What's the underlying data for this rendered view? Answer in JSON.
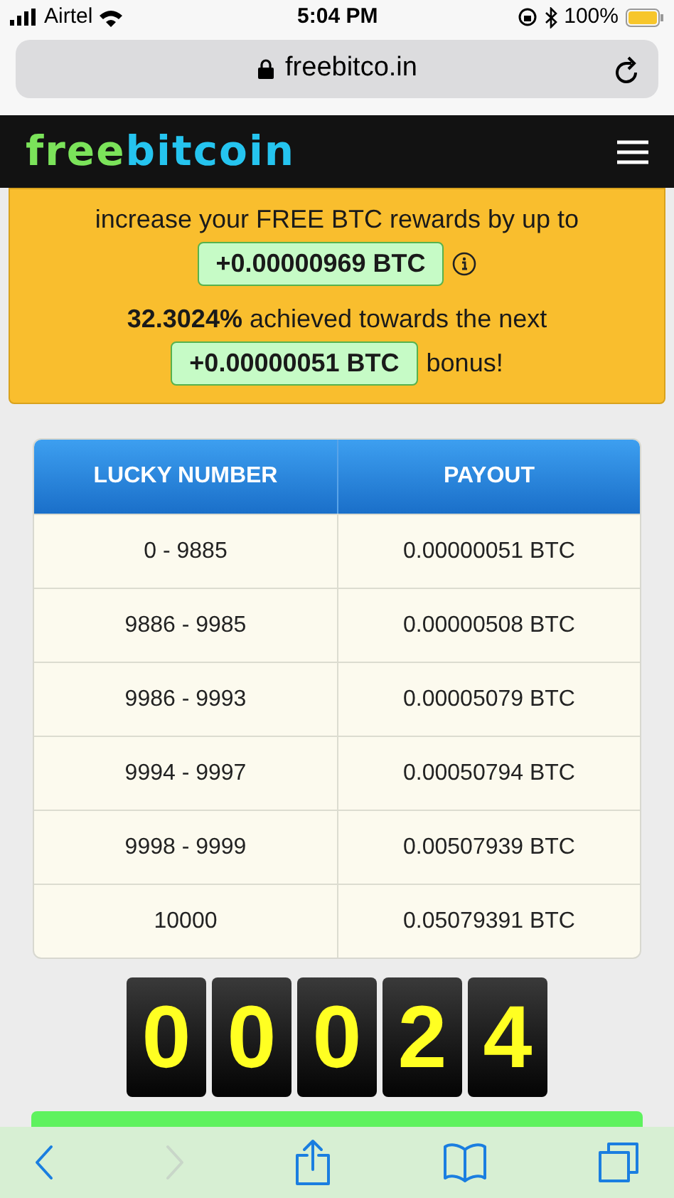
{
  "status_bar": {
    "carrier": "Airtel",
    "time": "5:04 PM",
    "battery": "100%"
  },
  "browser": {
    "url": "freebitco.in"
  },
  "site_header": {
    "logo_first": "free",
    "logo_second": "bitcoin"
  },
  "notice": {
    "line": "increase your FREE BTC rewards by up to",
    "reward": "+0.00000969 BTC",
    "progress": "**32.3024%** achieved towards the next",
    "bonus": "+0.00000051 BTC",
    "bonus_suffix": "bonus!"
  },
  "table": {
    "columns": [
      "LUCKY NUMBER",
      "PAYOUT"
    ],
    "rows": [
      [
        "0 - 9885",
        "0.00000051 BTC"
      ],
      [
        "9886 - 9985",
        "0.00000508 BTC"
      ],
      [
        "9986 - 9993",
        "0.00005079 BTC"
      ],
      [
        "9994 - 9997",
        "0.00050794 BTC"
      ],
      [
        "9998 - 9999",
        "0.00507939 BTC"
      ],
      [
        "10000",
        "0.05079391 BTC"
      ]
    ]
  },
  "digits": [
    "0",
    "0",
    "0",
    "2",
    "4"
  ],
  "toolbar": [
    {
      "kind": "back",
      "disabled": false
    },
    {
      "kind": "forward",
      "disabled": true
    },
    {
      "kind": "share",
      "disabled": false
    },
    {
      "kind": "bookmarks",
      "disabled": false
    },
    {
      "kind": "tabs",
      "disabled": false
    }
  ]
}
